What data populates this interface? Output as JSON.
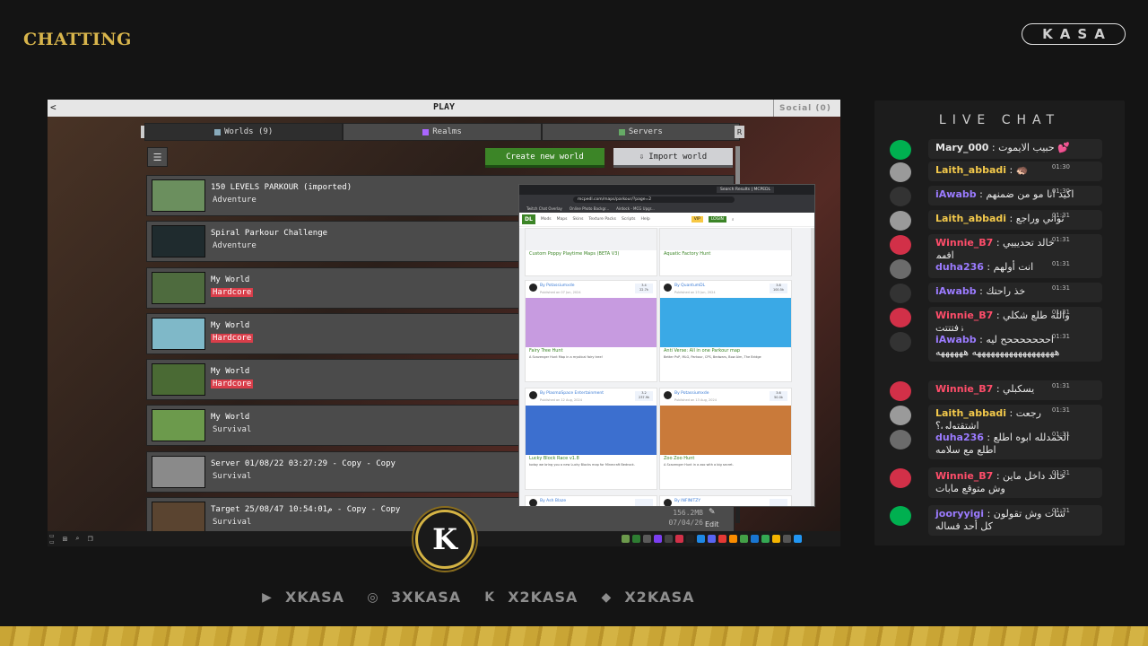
{
  "brand": {
    "title": "CHATTING",
    "badge": "KASA"
  },
  "game": {
    "title": "PLAY",
    "back": "<",
    "social": "Social (0)",
    "tabs": [
      "Worlds (9)",
      "Realms",
      "Servers"
    ],
    "tab_arrow_left": "L",
    "tab_arrow_right": "R",
    "buttons": {
      "create": "Create new world",
      "import": "Import world"
    },
    "worlds": [
      {
        "name": "150 LEVELS PARKOUR (imported)",
        "mode": "Adventure",
        "hardcore": false,
        "color": "#6b8f5e"
      },
      {
        "name": "Spiral Parkour Challenge",
        "mode": "Adventure",
        "hardcore": false,
        "color": "#1f2b2e"
      },
      {
        "name": "My World",
        "mode": "Hardcore",
        "hardcore": true,
        "color": "#4e6b3e"
      },
      {
        "name": "My World",
        "mode": "Hardcore",
        "hardcore": true,
        "color": "#7fb8c8"
      },
      {
        "name": "My World",
        "mode": "Hardcore",
        "hardcore": true,
        "color": "#4a6a34"
      },
      {
        "name": "My World",
        "mode": "Survival",
        "hardcore": false,
        "color": "#6c9a4c"
      },
      {
        "name": "Server 01/08/22 03:27:29 - Copy - Copy",
        "mode": "Survival",
        "hardcore": false,
        "color": "#8a8a8a"
      },
      {
        "name": "Target 25/08/47 10:54:01م - Copy - Copy",
        "mode": "Survival",
        "hardcore": false,
        "color": "#5a4430"
      }
    ],
    "meta": {
      "size": "156.2MB",
      "date": "07/04/26",
      "edit": "Edit"
    }
  },
  "browser": {
    "tab_title": "Search Results | MCPEDL",
    "url": "mcpedl.com/maps/parkour/?page=2",
    "bookmarks": [
      "Twitch Chat Overlay",
      "Online Photo Backgr...",
      "Airdock - MCG Upgr..."
    ],
    "nav": [
      "Mods",
      "Maps",
      "Skins",
      "Texture Packs",
      "Scripts",
      "Help"
    ],
    "vip": "VIP",
    "login": "LOGIN",
    "top_cards": [
      {
        "title": "Custom Poppy Playtime Maps (BETA V3)"
      },
      {
        "title": "Aquatic Factory Hunt"
      }
    ],
    "cards": [
      {
        "by": "By Potassiumxde",
        "published": "Published on 07 Jun, 2024",
        "rating": "3.4",
        "count": "22.7k",
        "title": "Fairy Tree Hunt",
        "desc": "A Scavenger Hunt Map in a mystical fairy tree!",
        "img_color": "#c79be0"
      },
      {
        "by": "By QuantumDL",
        "published": "Published on 23 Jun, 2024",
        "rating": "3.8",
        "count": "100.5k",
        "title": "Anti Verse: All in one Parkour map",
        "desc": "Better PvP, MLG, Parkour, CPS, Bedwars, Bow Aim, The Bridge",
        "img_color": "#3aa9e6"
      },
      {
        "by": "By PlasmaSpace Entertainment",
        "published": "Published on 12 Aug, 2024",
        "rating": "3.2",
        "count": "237.9k",
        "title": "Lucky Block Race v1.8",
        "desc": "today we bring you a new Lucky Blocks map for Minecraft Bedrock.",
        "img_color": "#3c6fcf"
      },
      {
        "by": "By Potassiumxde",
        "published": "Published on 13 Aug, 2024",
        "rating": "3.6",
        "count": "50.0k",
        "title": "Zoo Zoo Hunt",
        "desc": "A Scavenger Hunt in a zoo with a big secret.",
        "img_color": "#c97a3a"
      },
      {
        "by": "By Ash Blaze",
        "published": "",
        "rating": "",
        "count": "",
        "title": "",
        "desc": "",
        "img_color": "#ffffff"
      },
      {
        "by": "By INFINITZY",
        "published": "",
        "rating": "",
        "count": "",
        "title": "",
        "desc": "",
        "img_color": "#ffffff"
      }
    ]
  },
  "chat": {
    "title": "LIVE CHAT",
    "messages": [
      {
        "user": "Mary_000",
        "text": "حبيب الايموت 💕",
        "time": "",
        "color": "#e6e6e6",
        "avatar": "#00b050"
      },
      {
        "user": "Laith_abbadi",
        "text": "🦔",
        "time": "01:30",
        "color": "#f3c94b",
        "avatar": "#9a9a9a"
      },
      {
        "user": "iAwabb",
        "text": "اكيد انا مو من ضمنهم",
        "time": "01:30",
        "color": "#9b7bff",
        "avatar": "#333"
      },
      {
        "user": "Laith_abbadi",
        "text": "ثواني وراجع",
        "time": "01:31",
        "color": "#f3c94b",
        "avatar": "#9a9a9a"
      },
      {
        "user": "Winnie_B7",
        "text": "خالد تحديييي افهم",
        "time": "01:31",
        "color": "#ff4d6a",
        "avatar": "#d23048"
      },
      {
        "user": "duha236",
        "text": "انت أولهم",
        "time": "01:31",
        "color": "#9b7bff",
        "avatar": "#6b6b6b"
      },
      {
        "user": "iAwabb",
        "text": "خذ راحتك",
        "time": "01:31",
        "color": "#9b7bff",
        "avatar": "#333"
      },
      {
        "user": "Winnie_B7",
        "text": "والله طلع شكلي زفتتتت",
        "time": "01:31",
        "color": "#ff4d6a",
        "avatar": "#d23048"
      },
      {
        "user": "iAwabb",
        "text": "احححححححح ليه ههههههههههههههههههه ههههههه",
        "time": "01:31",
        "color": "#9b7bff",
        "avatar": "#333"
      },
      {
        "user": "Winnie_B7",
        "text": "يسكبلي",
        "time": "01:31",
        "color": "#ff4d6a",
        "avatar": "#d23048"
      },
      {
        "user": "Laith_abbadi",
        "text": "رجعت اشتقتولي؟",
        "time": "01:31",
        "color": "#f3c94b",
        "avatar": "#9a9a9a"
      },
      {
        "user": "duha236",
        "text": "الحمدلله ابوه اطلع اطلع مع سلامه",
        "time": "01:31",
        "color": "#9b7bff",
        "avatar": "#6b6b6b"
      },
      {
        "user": "Winnie_B7",
        "text": "خالد داخل ماين وش متوقع مابات",
        "time": "01:31",
        "color": "#ff4d6a",
        "avatar": "#d23048"
      },
      {
        "user": "jooryyigi",
        "text": "شات وش تقولون كل أحد فساله",
        "time": "01:31",
        "color": "#9b7bff",
        "avatar": "#00b050"
      }
    ]
  },
  "socials": [
    {
      "icon": "youtube-icon",
      "label": "XKASA"
    },
    {
      "icon": "instagram-icon",
      "label": "3XKASA"
    },
    {
      "icon": "kick-icon",
      "label": "X2KASA"
    },
    {
      "icon": "snapchat-icon",
      "label": "X2KASA"
    }
  ],
  "logo": {
    "letter": "K"
  },
  "colors": {
    "gold": "#d4b344",
    "green": "#3c8527",
    "hardcore": "#d93e4a"
  }
}
